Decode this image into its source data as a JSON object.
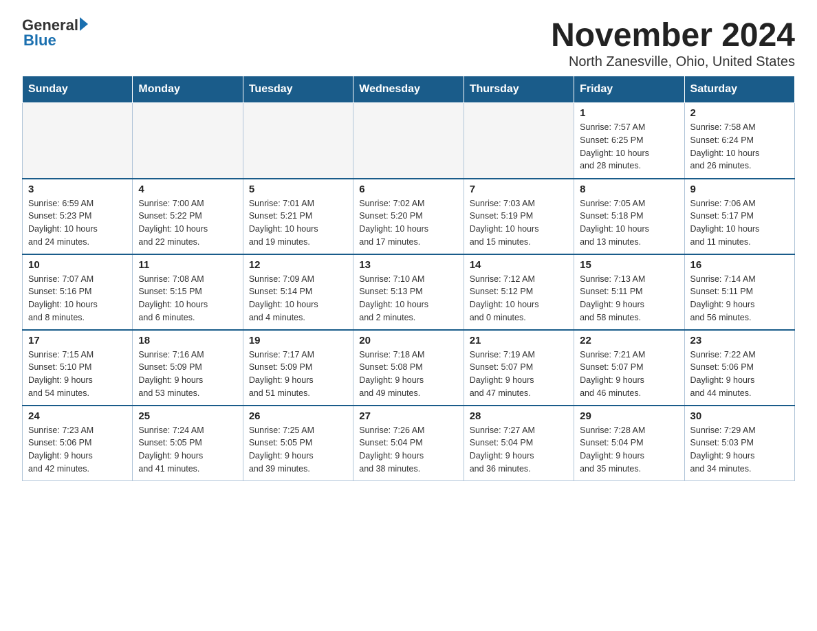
{
  "logo": {
    "general": "General",
    "blue": "Blue"
  },
  "header": {
    "month_year": "November 2024",
    "location": "North Zanesville, Ohio, United States"
  },
  "weekdays": [
    "Sunday",
    "Monday",
    "Tuesday",
    "Wednesday",
    "Thursday",
    "Friday",
    "Saturday"
  ],
  "weeks": [
    {
      "days": [
        {
          "num": "",
          "info": ""
        },
        {
          "num": "",
          "info": ""
        },
        {
          "num": "",
          "info": ""
        },
        {
          "num": "",
          "info": ""
        },
        {
          "num": "",
          "info": ""
        },
        {
          "num": "1",
          "info": "Sunrise: 7:57 AM\nSunset: 6:25 PM\nDaylight: 10 hours\nand 28 minutes."
        },
        {
          "num": "2",
          "info": "Sunrise: 7:58 AM\nSunset: 6:24 PM\nDaylight: 10 hours\nand 26 minutes."
        }
      ]
    },
    {
      "days": [
        {
          "num": "3",
          "info": "Sunrise: 6:59 AM\nSunset: 5:23 PM\nDaylight: 10 hours\nand 24 minutes."
        },
        {
          "num": "4",
          "info": "Sunrise: 7:00 AM\nSunset: 5:22 PM\nDaylight: 10 hours\nand 22 minutes."
        },
        {
          "num": "5",
          "info": "Sunrise: 7:01 AM\nSunset: 5:21 PM\nDaylight: 10 hours\nand 19 minutes."
        },
        {
          "num": "6",
          "info": "Sunrise: 7:02 AM\nSunset: 5:20 PM\nDaylight: 10 hours\nand 17 minutes."
        },
        {
          "num": "7",
          "info": "Sunrise: 7:03 AM\nSunset: 5:19 PM\nDaylight: 10 hours\nand 15 minutes."
        },
        {
          "num": "8",
          "info": "Sunrise: 7:05 AM\nSunset: 5:18 PM\nDaylight: 10 hours\nand 13 minutes."
        },
        {
          "num": "9",
          "info": "Sunrise: 7:06 AM\nSunset: 5:17 PM\nDaylight: 10 hours\nand 11 minutes."
        }
      ]
    },
    {
      "days": [
        {
          "num": "10",
          "info": "Sunrise: 7:07 AM\nSunset: 5:16 PM\nDaylight: 10 hours\nand 8 minutes."
        },
        {
          "num": "11",
          "info": "Sunrise: 7:08 AM\nSunset: 5:15 PM\nDaylight: 10 hours\nand 6 minutes."
        },
        {
          "num": "12",
          "info": "Sunrise: 7:09 AM\nSunset: 5:14 PM\nDaylight: 10 hours\nand 4 minutes."
        },
        {
          "num": "13",
          "info": "Sunrise: 7:10 AM\nSunset: 5:13 PM\nDaylight: 10 hours\nand 2 minutes."
        },
        {
          "num": "14",
          "info": "Sunrise: 7:12 AM\nSunset: 5:12 PM\nDaylight: 10 hours\nand 0 minutes."
        },
        {
          "num": "15",
          "info": "Sunrise: 7:13 AM\nSunset: 5:11 PM\nDaylight: 9 hours\nand 58 minutes."
        },
        {
          "num": "16",
          "info": "Sunrise: 7:14 AM\nSunset: 5:11 PM\nDaylight: 9 hours\nand 56 minutes."
        }
      ]
    },
    {
      "days": [
        {
          "num": "17",
          "info": "Sunrise: 7:15 AM\nSunset: 5:10 PM\nDaylight: 9 hours\nand 54 minutes."
        },
        {
          "num": "18",
          "info": "Sunrise: 7:16 AM\nSunset: 5:09 PM\nDaylight: 9 hours\nand 53 minutes."
        },
        {
          "num": "19",
          "info": "Sunrise: 7:17 AM\nSunset: 5:09 PM\nDaylight: 9 hours\nand 51 minutes."
        },
        {
          "num": "20",
          "info": "Sunrise: 7:18 AM\nSunset: 5:08 PM\nDaylight: 9 hours\nand 49 minutes."
        },
        {
          "num": "21",
          "info": "Sunrise: 7:19 AM\nSunset: 5:07 PM\nDaylight: 9 hours\nand 47 minutes."
        },
        {
          "num": "22",
          "info": "Sunrise: 7:21 AM\nSunset: 5:07 PM\nDaylight: 9 hours\nand 46 minutes."
        },
        {
          "num": "23",
          "info": "Sunrise: 7:22 AM\nSunset: 5:06 PM\nDaylight: 9 hours\nand 44 minutes."
        }
      ]
    },
    {
      "days": [
        {
          "num": "24",
          "info": "Sunrise: 7:23 AM\nSunset: 5:06 PM\nDaylight: 9 hours\nand 42 minutes."
        },
        {
          "num": "25",
          "info": "Sunrise: 7:24 AM\nSunset: 5:05 PM\nDaylight: 9 hours\nand 41 minutes."
        },
        {
          "num": "26",
          "info": "Sunrise: 7:25 AM\nSunset: 5:05 PM\nDaylight: 9 hours\nand 39 minutes."
        },
        {
          "num": "27",
          "info": "Sunrise: 7:26 AM\nSunset: 5:04 PM\nDaylight: 9 hours\nand 38 minutes."
        },
        {
          "num": "28",
          "info": "Sunrise: 7:27 AM\nSunset: 5:04 PM\nDaylight: 9 hours\nand 36 minutes."
        },
        {
          "num": "29",
          "info": "Sunrise: 7:28 AM\nSunset: 5:04 PM\nDaylight: 9 hours\nand 35 minutes."
        },
        {
          "num": "30",
          "info": "Sunrise: 7:29 AM\nSunset: 5:03 PM\nDaylight: 9 hours\nand 34 minutes."
        }
      ]
    }
  ]
}
